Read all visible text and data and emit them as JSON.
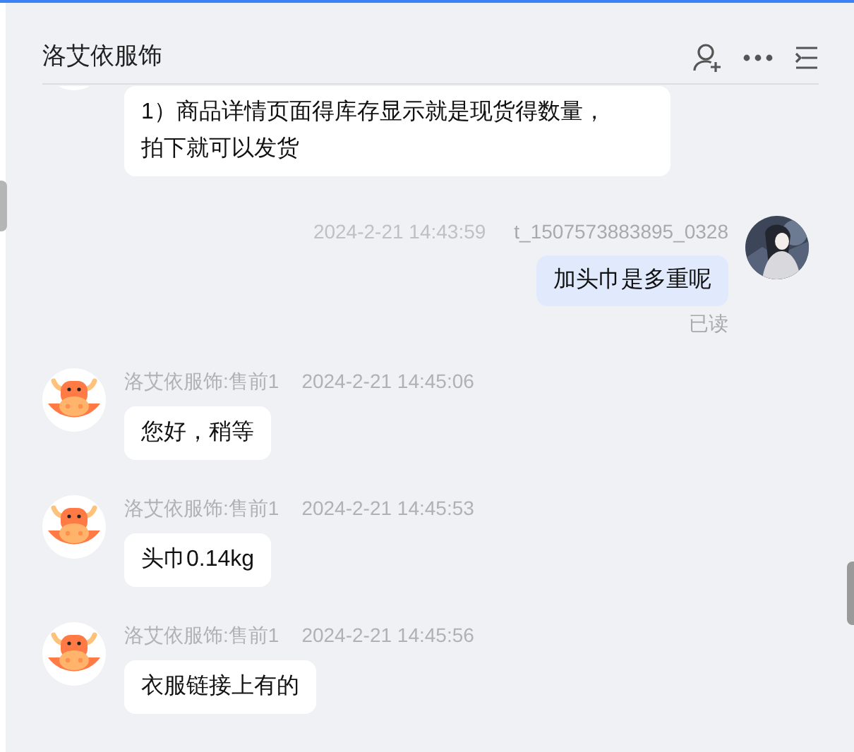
{
  "header": {
    "title": "洛艾依服饰"
  },
  "messages": [
    {
      "kind": "agent",
      "text": "1）商品详情页面得库存显示就是现货得数量，拍下就可以发货"
    },
    {
      "kind": "user",
      "time": "2024-2-21 14:43:59",
      "sender": "t_1507573883895_0328",
      "text": "加头巾是多重呢",
      "status": "已读"
    },
    {
      "kind": "agent",
      "sender": "洛艾依服饰:售前1",
      "time": "2024-2-21 14:45:06",
      "text": "您好，稍等"
    },
    {
      "kind": "agent",
      "sender": "洛艾依服饰:售前1",
      "time": "2024-2-21 14:45:53",
      "text": "头巾0.14kg"
    },
    {
      "kind": "agent",
      "sender": "洛艾依服饰:售前1",
      "time": "2024-2-21 14:45:56",
      "text": "衣服链接上有的"
    }
  ]
}
